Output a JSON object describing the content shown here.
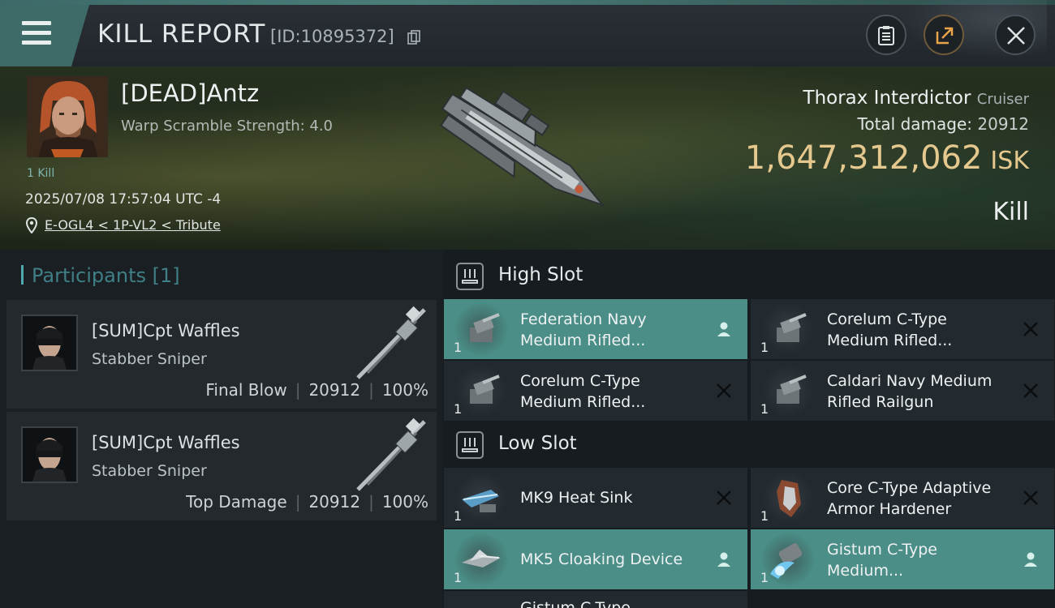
{
  "header": {
    "title": "KILL REPORT",
    "report_id": "[ID:10895372]"
  },
  "victim": {
    "name": "[DEAD]Antz",
    "warp_scramble": "Warp Scramble Strength: 4.0",
    "kill_count": "1 Kill",
    "datetime": "2025/07/08 17:57:04 UTC -4",
    "location": "E-OGL4 < 1P-VL2 < Tribute"
  },
  "ship": {
    "name": "Thorax Interdictor",
    "class": "Cruiser",
    "damage_label": "Total damage:",
    "damage_value": "20912",
    "isk_value": "1,647,312,062",
    "isk_unit": "ISK",
    "outcome": "Kill"
  },
  "participants": {
    "heading": "Participants",
    "count": "[1]",
    "rows": [
      {
        "name": "[SUM]Cpt Waffles",
        "ship": "Stabber Sniper",
        "role": "Final Blow",
        "damage": "20912",
        "percent": "100%"
      },
      {
        "name": "[SUM]Cpt Waffles",
        "ship": "Stabber Sniper",
        "role": "Top Damage",
        "damage": "20912",
        "percent": "100%"
      }
    ]
  },
  "high_slot": {
    "label": "High Slot",
    "items": [
      {
        "line1": "Federation Navy",
        "line2": "Medium Rifled...",
        "qty": "1",
        "status": "person-icon"
      },
      {
        "line1": "Corelum C-Type",
        "line2": "Medium Rifled...",
        "qty": "1",
        "status": "x-icon"
      },
      {
        "line1": "Corelum C-Type",
        "line2": "Medium Rifled...",
        "qty": "1",
        "status": "x-icon"
      },
      {
        "line1": "Caldari Navy Medium",
        "line2": "Rifled Railgun",
        "qty": "1",
        "status": "x-icon"
      }
    ]
  },
  "low_slot": {
    "label": "Low Slot",
    "items": [
      {
        "line1": "MK9 Heat Sink",
        "line2": "",
        "qty": "1",
        "status": "x-icon"
      },
      {
        "line1": "Core C-Type Adaptive",
        "line2": " Armor Hardener",
        "qty": "1",
        "status": "x-icon"
      },
      {
        "line1": "MK5 Cloaking Device",
        "line2": "",
        "qty": "1",
        "status": "person-icon"
      },
      {
        "line1": "Gistum C-Type",
        "line2": "Medium...",
        "qty": "1",
        "status": "person-icon"
      },
      {
        "line1": "Gistum C-Type",
        "line2": "",
        "qty": "",
        "status": ""
      }
    ]
  },
  "colors": {
    "accent_teal": "#4a8e87",
    "isk_gold": "#e5c88e",
    "participants_heading": "#3f7f85"
  }
}
